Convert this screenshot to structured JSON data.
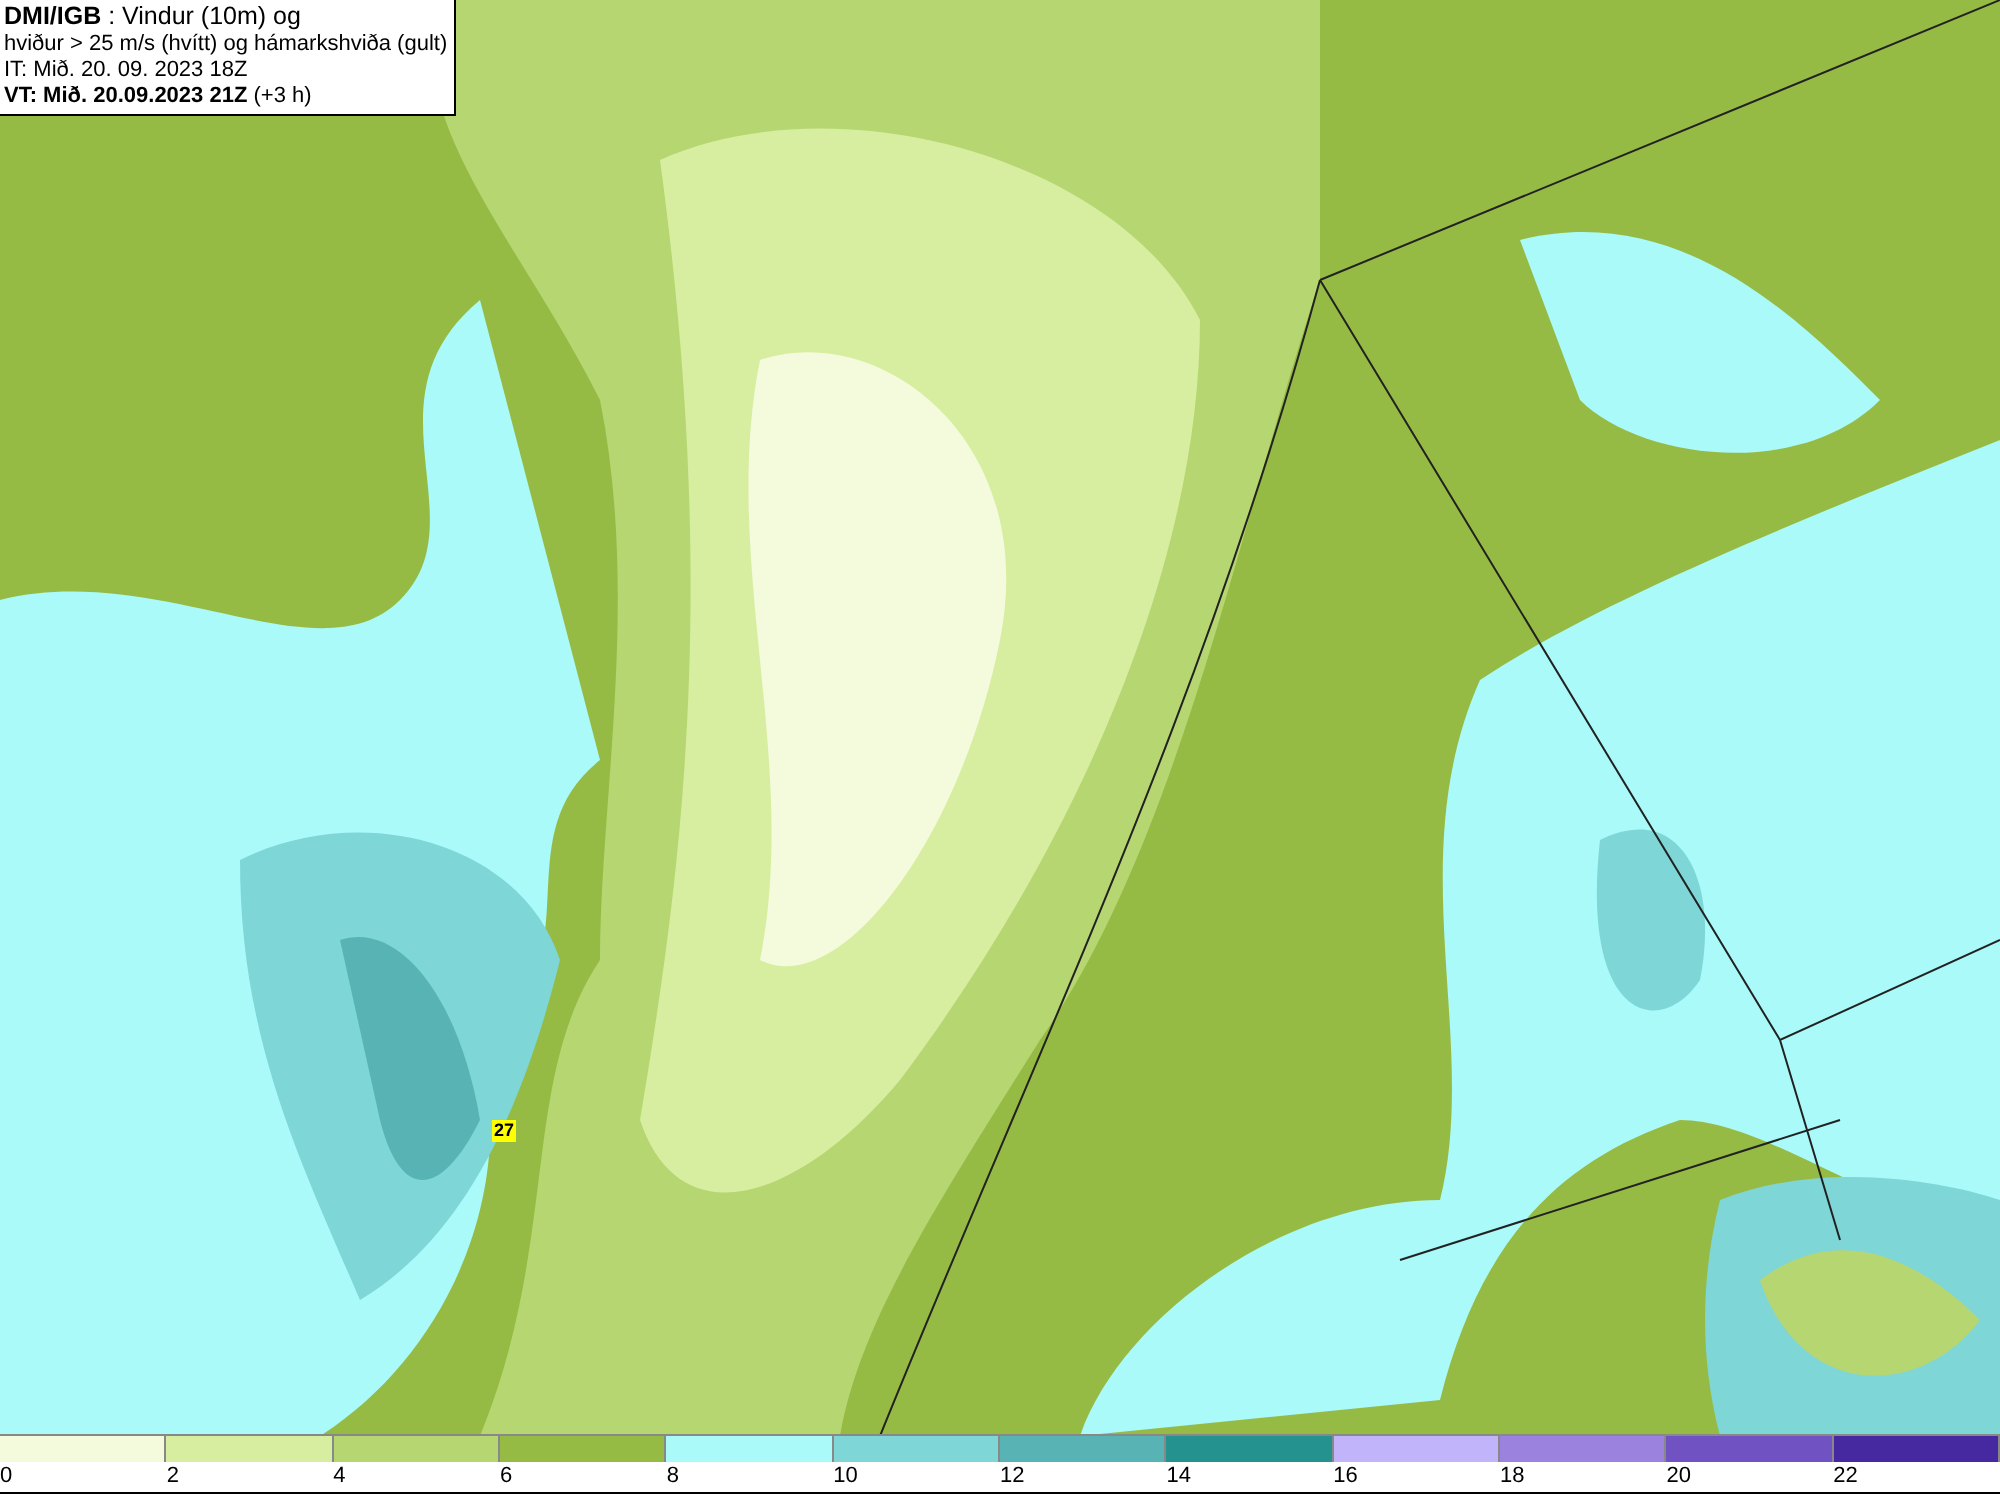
{
  "map": {
    "title_box": {
      "lines": [
        "**DMI/IGB** : Vindur (10m) og",
        "hviður > 25 m/s (hvítt) og hámarkshviða (gult)",
        "IT: Mið. 20. 09. 2023 18Z",
        "**VT: Mið. 20.09.2023 21Z** (+3 h)"
      ]
    },
    "gust_marker": {
      "label": "27"
    }
  },
  "legend": {
    "segments": [
      {
        "label": "0",
        "color": "#f4fadc"
      },
      {
        "label": "2",
        "color": "#d7eea0"
      },
      {
        "label": "4",
        "color": "#b6d672"
      },
      {
        "label": "6",
        "color": "#96bb44"
      },
      {
        "label": "8",
        "color": "#aafafa"
      },
      {
        "label": "10",
        "color": "#7ed6d6"
      },
      {
        "label": "12",
        "color": "#58b4b4"
      },
      {
        "label": "14",
        "color": "#24928e"
      },
      {
        "label": "16",
        "color": "#c2b4fa"
      },
      {
        "label": "18",
        "color": "#9a82de"
      },
      {
        "label": "20",
        "color": "#7052c2"
      },
      {
        "label": "22",
        "color": "#4628a0"
      }
    ]
  }
}
